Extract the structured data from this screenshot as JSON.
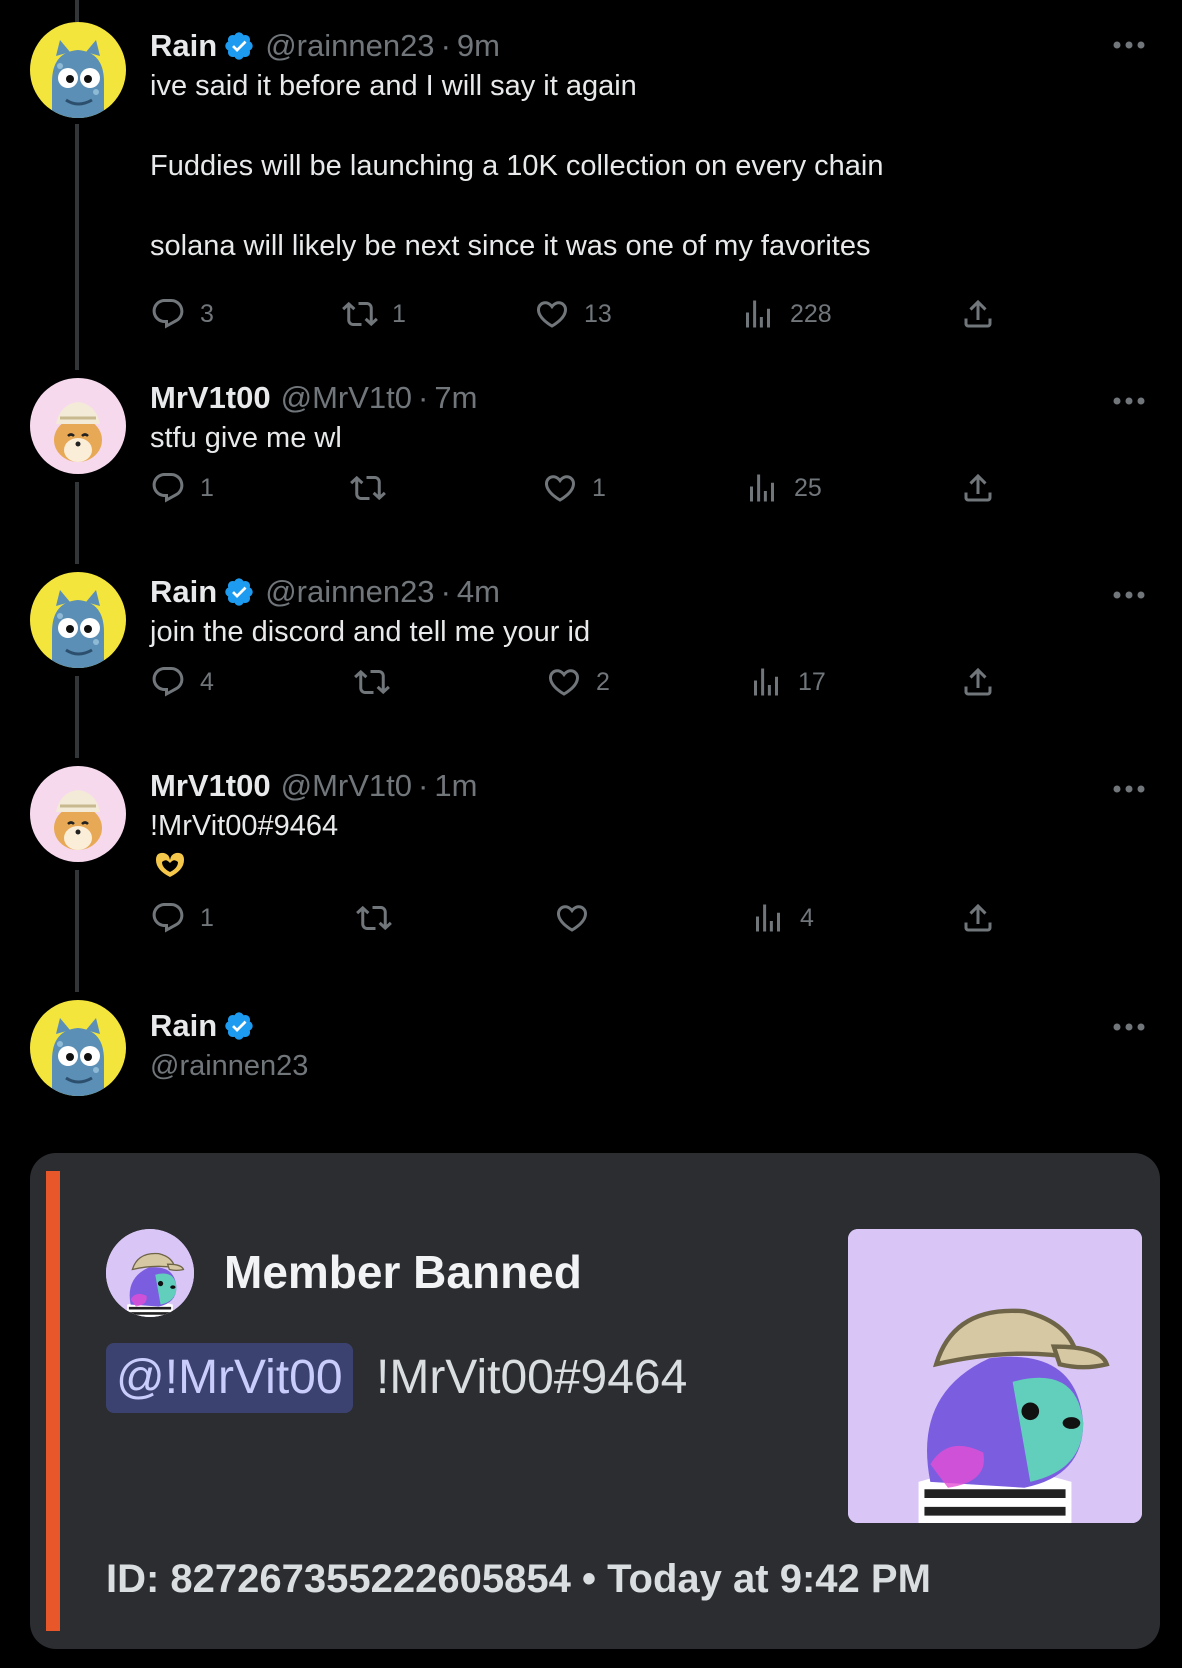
{
  "tweets": [
    {
      "name": "Rain",
      "handle": "@rainnen23",
      "dot": "·",
      "time": "9m",
      "text": "ive said it before and I will say it again\n\nFuddies will be launching a 10K collection on every chain\n\nsolana will likely be next since it was one of my favorites",
      "replies": "3",
      "retweets": "1",
      "likes": "13",
      "views": "228"
    },
    {
      "name": "MrV1t00",
      "handle": "@MrV1t0",
      "dot": "·",
      "time": "7m",
      "text": "stfu give me wl",
      "replies": "1",
      "retweets": "",
      "likes": "1",
      "views": "25"
    },
    {
      "name": "Rain",
      "handle": "@rainnen23",
      "dot": "·",
      "time": "4m",
      "text": "join the discord and tell me your id",
      "replies": "4",
      "retweets": "",
      "likes": "2",
      "views": "17"
    },
    {
      "name": "MrV1t00",
      "handle": "@MrV1t0",
      "dot": "·",
      "time": "1m",
      "text": "!MrVit00#9464",
      "replies": "1",
      "retweets": "",
      "likes": "",
      "views": "4"
    }
  ],
  "main_tweet": {
    "name": "Rain",
    "handle": "@rainnen23"
  },
  "embed": {
    "title": "Member Banned",
    "mention": "@!MrVit00",
    "tag": "!MrVit00#9464",
    "footer": "ID: 827267355222605854 • Today at 9:42 PM"
  },
  "colors": {
    "background": "#000000",
    "text": "#e7e9ea",
    "muted": "#71767b",
    "verified": "#1d9bf0",
    "embed_bg": "#2b2d31",
    "embed_accent": "#e8572a",
    "mention_bg": "#3c4270"
  },
  "icons": [
    "reply-icon",
    "retweet-icon",
    "like-icon",
    "views-icon",
    "share-icon",
    "more-icon",
    "verified-icon",
    "heart-hands-emoji"
  ]
}
